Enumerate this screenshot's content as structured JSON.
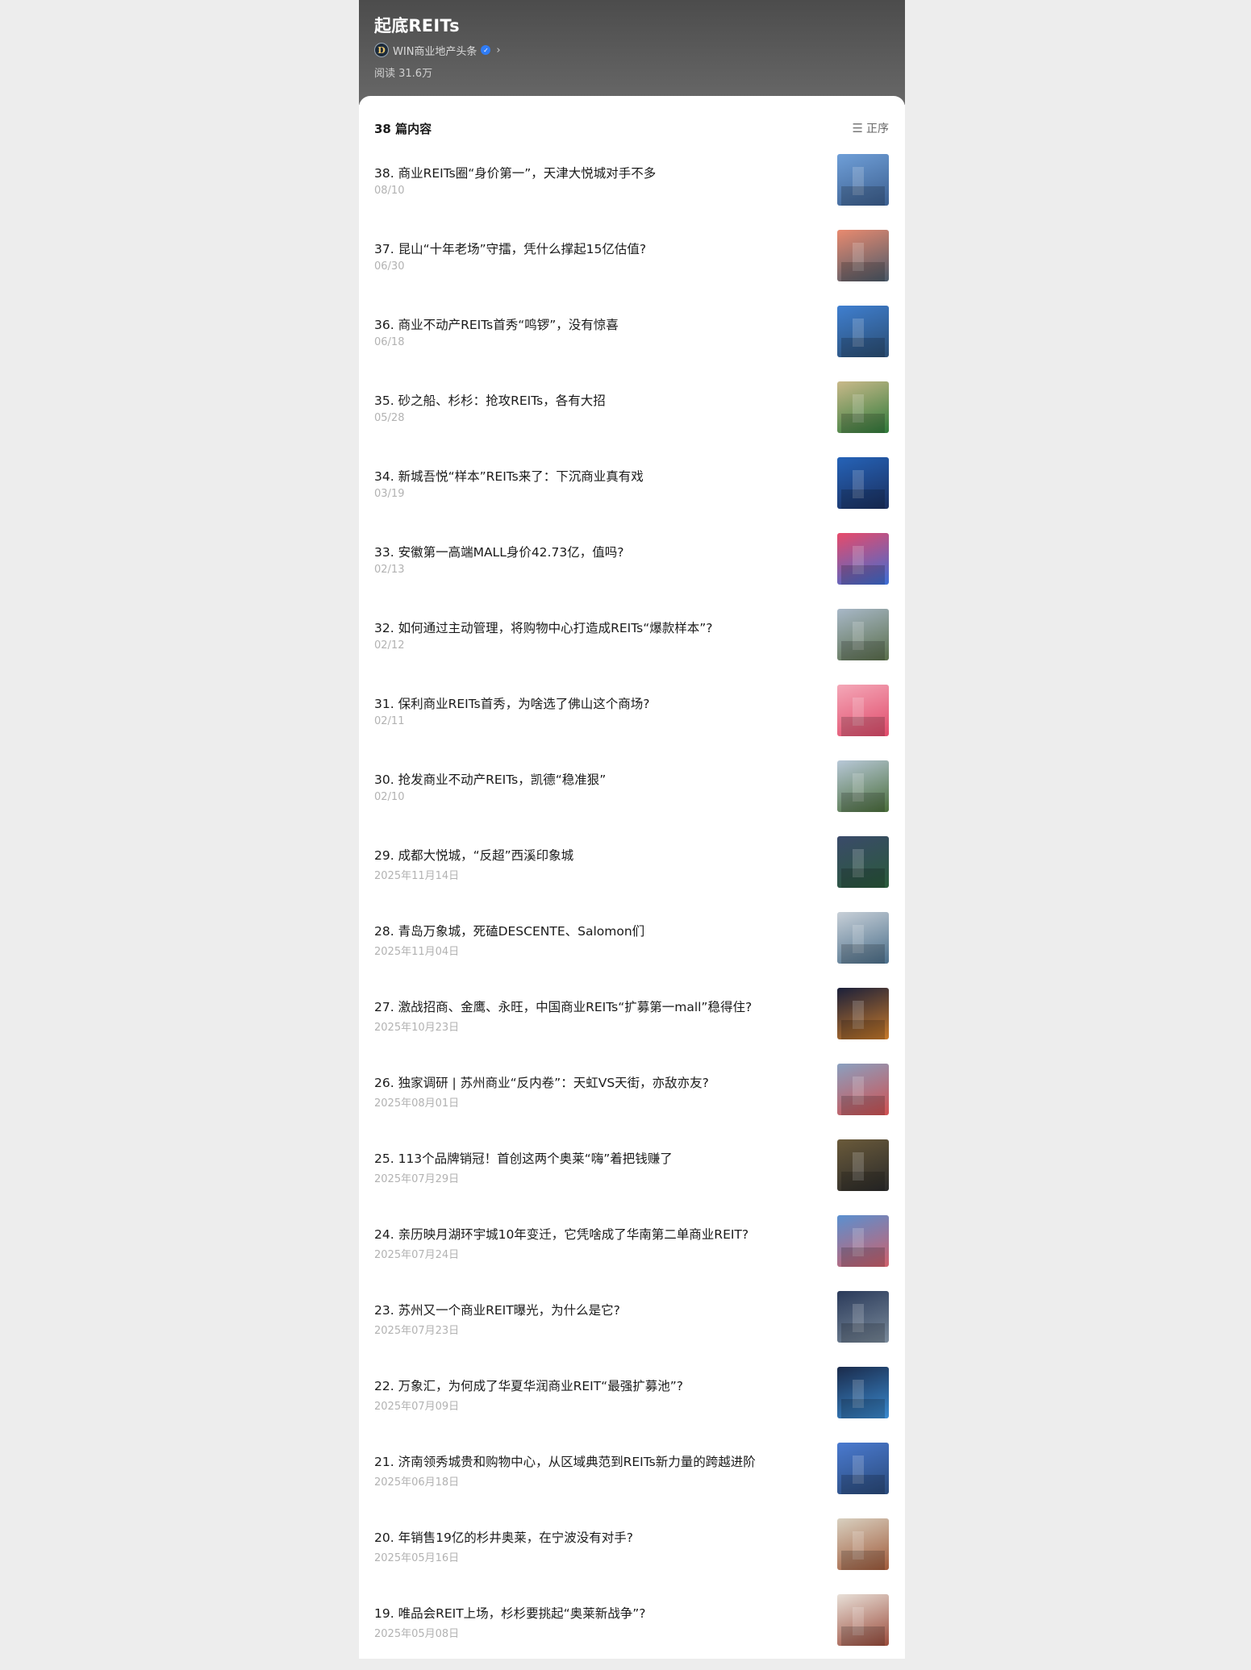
{
  "header": {
    "title": "起底REITs",
    "author": "WIN商业地产头条",
    "avatar_letter": "D",
    "verified_glyph": "✓",
    "read_count": "阅读 31.6万"
  },
  "list_header": {
    "count_label": "38 篇内容",
    "sort_label": "正序",
    "sort_icon": "☰"
  },
  "articles": [
    {
      "title": "38. 商业REITs圈“身价第一”，天津大悦城对手不多",
      "date": "08/10",
      "thumb_colors": [
        "#6f9fd8",
        "#3c5f8f"
      ]
    },
    {
      "title": "37. 昆山“十年老场”守擂，凭什么撑起15亿估值?",
      "date": "06/30",
      "thumb_colors": [
        "#e98a6f",
        "#4a5a6a"
      ]
    },
    {
      "title": "36. 商业不动产REITs首秀“鸣锣”，没有惊喜",
      "date": "06/18",
      "thumb_colors": [
        "#3f7fd0",
        "#2b4d72"
      ]
    },
    {
      "title": "35. 砂之船、杉杉：抢攻REITs，各有大招",
      "date": "05/28",
      "thumb_colors": [
        "#c9b98a",
        "#2f7a3a"
      ]
    },
    {
      "title": "34. 新城吾悦“样本”REITs来了：下沉商业真有戏",
      "date": "03/19",
      "thumb_colors": [
        "#2563b8",
        "#1b2f5e"
      ]
    },
    {
      "title": "33. 安徽第一高端MALL身价42.73亿，值吗?",
      "date": "02/13",
      "thumb_colors": [
        "#e84a6a",
        "#3a6ed6"
      ]
    },
    {
      "title": "32. 如何通过主动管理，将购物中心打造成REITs“爆款样本”?",
      "date": "02/12",
      "thumb_colors": [
        "#a8b8c8",
        "#5a6e4a"
      ]
    },
    {
      "title": "31. 保利商业REITs首秀，为啥选了佛山这个商场?",
      "date": "02/11",
      "thumb_colors": [
        "#f4a8b8",
        "#e04a6a"
      ]
    },
    {
      "title": "30. 抢发商业不动产REITs，凯德“稳准狠”",
      "date": "02/10",
      "thumb_colors": [
        "#b8c8d8",
        "#4a6e3a"
      ]
    },
    {
      "title": "29. 成都大悦城，“反超”西溪印象城",
      "date": "2025年11月14日",
      "thumb_colors": [
        "#3a4a6a",
        "#2a5a3a"
      ]
    },
    {
      "title": "28. 青岛万象城，死磕DESCENTE、Salomon们",
      "date": "2025年11月04日",
      "thumb_colors": [
        "#c8d0d8",
        "#4a6e8a"
      ]
    },
    {
      "title": "27. 激战招商、金鹰、永旺，中国商业REITs“扩募第一mall”稳得住?",
      "date": "2025年10月23日",
      "thumb_colors": [
        "#1a1f3a",
        "#c87a2a"
      ]
    },
    {
      "title": "26. 独家调研 | 苏州商业“反内卷”：天虹VS天街，亦敌亦友?",
      "date": "2025年08月01日",
      "thumb_colors": [
        "#8aa0c0",
        "#d05050"
      ]
    },
    {
      "title": "25. 113个品牌销冠！首创这两个奥莱“嗨”着把钱赚了",
      "date": "2025年07月29日",
      "thumb_colors": [
        "#6a5a3a",
        "#2a2a2a"
      ]
    },
    {
      "title": "24. 亲历映月湖环宇城10年变迁，它凭啥成了华南第二单商业REIT?",
      "date": "2025年07月24日",
      "thumb_colors": [
        "#5a90d0",
        "#d0606a"
      ]
    },
    {
      "title": "23. 苏州又一个商业REIT曝光，为什么是它?",
      "date": "2025年07月23日",
      "thumb_colors": [
        "#2a3a5a",
        "#7a8a9a"
      ]
    },
    {
      "title": "22. 万象汇，为何成了华夏华润商业REIT“最强扩募池”?",
      "date": "2025年07月09日",
      "thumb_colors": [
        "#1a2a4a",
        "#3a8ad0"
      ]
    },
    {
      "title": "21. 济南领秀城贵和购物中心，从区域典范到REITs新力量的跨越进阶",
      "date": "2025年06月18日",
      "thumb_colors": [
        "#4a7ad0",
        "#2a4a7a"
      ]
    },
    {
      "title": "20. 年销售19亿的杉井奥莱，在宁波没有对手?",
      "date": "2025年05月16日",
      "thumb_colors": [
        "#d8d0c0",
        "#a05a3a"
      ]
    },
    {
      "title": "19. 唯品会REIT上场，杉杉要挑起“奥莱新战争”?",
      "date": "2025年05月08日",
      "thumb_colors": [
        "#e8e0d8",
        "#9a4a3a"
      ]
    }
  ]
}
